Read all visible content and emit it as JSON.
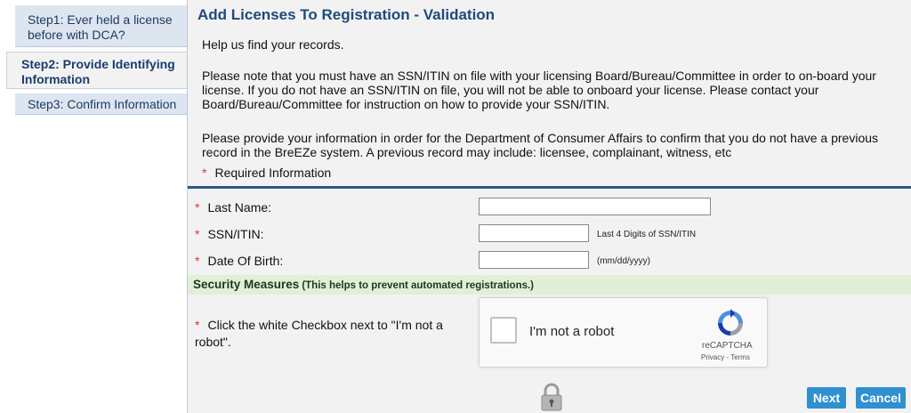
{
  "sidebar": {
    "steps": [
      {
        "label": "Step1: Ever held a license before with DCA?"
      },
      {
        "label": "Step2: Provide Identifying Information"
      },
      {
        "label": "Step3: Confirm Information"
      }
    ]
  },
  "main": {
    "title": "Add Licenses To Registration - Validation",
    "help_text": "Help us find your records.",
    "note_text": "Please note that you must have an SSN/ITIN on file with your licensing Board/Bureau/Committee in order to on-board your license. If you do not have an SSN/ITIN on file, you will not be able to onboard your license. Please contact your Board/Bureau/Committee for instruction on how to provide your SSN/ITIN.",
    "provide_text": "Please provide your information in order for the Department of Consumer Affairs to confirm that you do not have a previous record in the BreEZe system. A previous record may include: licensee, complainant, witness, etc",
    "required_marker": "*",
    "required_label": "Required Information"
  },
  "form": {
    "last_name": {
      "label": "Last Name:",
      "value": ""
    },
    "ssn": {
      "label": "SSN/ITIN:",
      "value": "",
      "hint": "Last 4 Digits of SSN/ITIN"
    },
    "dob": {
      "label": "Date Of Birth:",
      "value": "",
      "hint": "(mm/dd/yyyy)"
    }
  },
  "security": {
    "title": "Security Measures",
    "subtitle": "(This helps to prevent automated registrations.)",
    "instruction": "Click the white Checkbox next to \"I'm not a robot\"."
  },
  "captcha": {
    "label": "I'm not a robot",
    "brand": "reCAPTCHA",
    "links": "Privacy - Terms",
    "checked": false
  },
  "buttons": {
    "next": "Next",
    "cancel": "Cancel"
  },
  "icons": {
    "captcha_logo": "recaptcha-icon",
    "lock": "lock-icon"
  },
  "colors": {
    "accent": "#2f8fcf",
    "title": "#1e4a7a",
    "security_bar": "#e2efd8",
    "required": "#d9362b"
  }
}
